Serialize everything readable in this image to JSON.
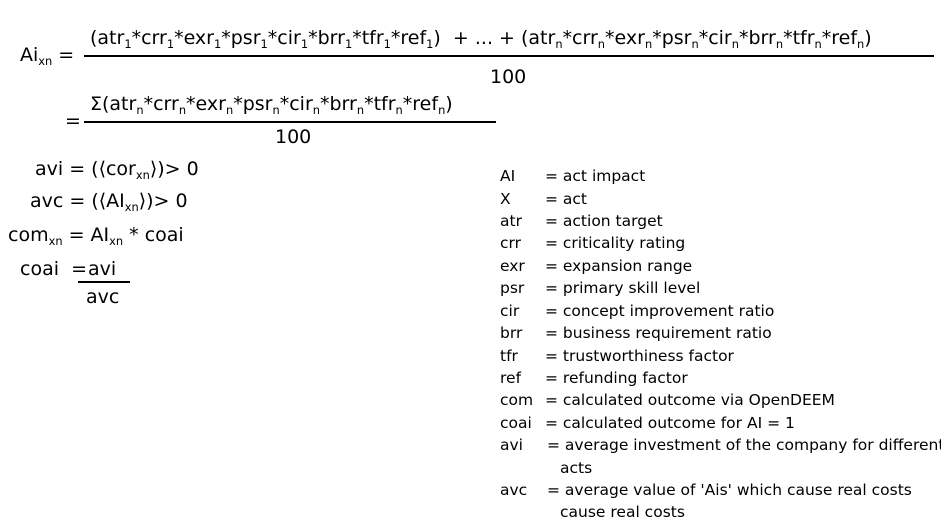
{
  "formula": {
    "lhs": "Ai",
    "lhs_sub": "xn",
    "eq": "=",
    "eq2": "=",
    "num1_html": "(atr<sub>1</sub>*crr<sub>1</sub>*exr<sub>1</sub>*psr<sub>1</sub>*cir<sub>1</sub>*brr<sub>1</sub>*tfr<sub>1</sub>*ref<sub>1</sub>)&nbsp; + ... + (atr<sub>n</sub>*crr<sub>n</sub>*exr<sub>n</sub>*psr<sub>n</sub>*cir<sub>n</sub>*brr<sub>n</sub>*tfr<sub>n</sub>*ref<sub>n</sub>)",
    "den1": "100",
    "num2_html": "Σ(atr<sub>n</sub>*crr<sub>n</sub>*exr<sub>n</sub>*psr<sub>n</sub>*cir<sub>n</sub>*brr<sub>n</sub>*tfr<sub>n</sub>*ref<sub>n</sub>)",
    "den2": "100"
  },
  "equations": {
    "avi_html": "avi = (⟨cor<sub>xn</sub>⟩)&gt; 0",
    "avc_html": "avc = (⟨AI<sub>xn</sub>⟩)&gt; 0",
    "com_html": "com<sub>xn</sub> = AI<sub>xn</sub> * coai",
    "coai_lhs": "coai",
    "coai_eq": "=",
    "coai_num": "avi",
    "coai_den": "avc"
  },
  "legend": [
    {
      "sym": "AI",
      "def": "= act impact"
    },
    {
      "sym": "X",
      "def": "= act"
    },
    {
      "sym": "atr",
      "def": "= action target"
    },
    {
      "sym": "crr",
      "def": "= criticality rating"
    },
    {
      "sym": "exr",
      "def": "= expansion range"
    },
    {
      "sym": "psr",
      "def": "= primary skill level"
    },
    {
      "sym": "cir",
      "def": "= concept improvement ratio"
    },
    {
      "sym": "brr",
      "def": "= business requirement ratio"
    },
    {
      "sym": "tfr",
      "def": "= trustworthiness factor"
    },
    {
      "sym": "ref",
      "def": "= refunding factor"
    },
    {
      "sym": "com",
      "def": "= calculated outcome via OpenDEEM"
    },
    {
      "sym": "coai",
      "def": "= calculated outcome for AI = 1"
    },
    {
      "sym": "avi",
      "def": "= average investment of the company for different"
    },
    {
      "sym": "avc",
      "def": "= average value of  'Ais' which cause real costs"
    }
  ],
  "legend_cont": {
    "avi": "acts",
    "avc": "cause real costs"
  }
}
